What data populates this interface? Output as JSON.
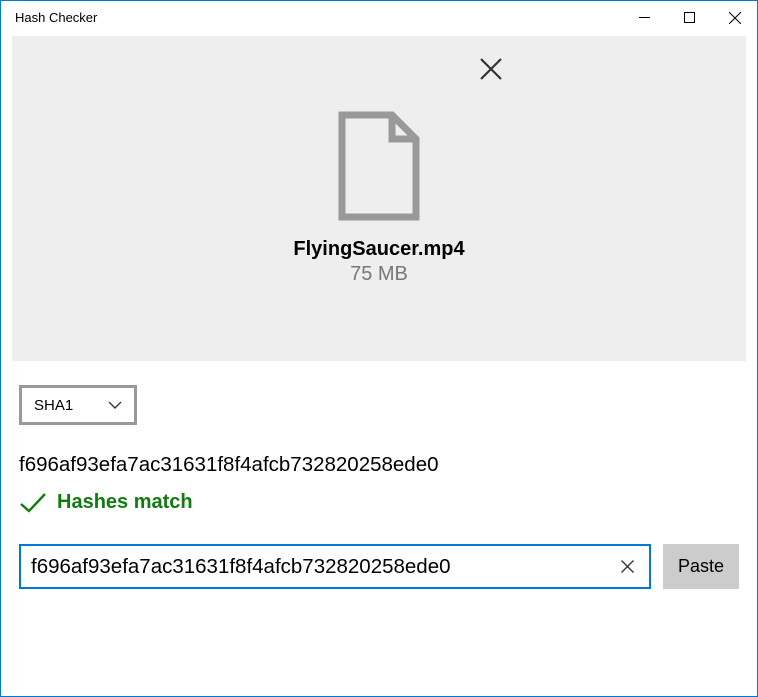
{
  "window": {
    "title": "Hash Checker"
  },
  "file": {
    "name": "FlyingSaucer.mp4",
    "size": "75 MB"
  },
  "algorithm": {
    "selected": "SHA1"
  },
  "computed_hash": "f696af93efa7ac31631f8f4afcb732820258ede0",
  "status": {
    "match_label": "Hashes match"
  },
  "compare": {
    "input_value": "f696af93efa7ac31631f8f4afcb732820258ede0",
    "paste_label": "Paste"
  },
  "colors": {
    "accent": "#0078d7",
    "success": "#107c10",
    "panel_bg": "#eeeeee",
    "button_bg": "#cccccc"
  }
}
